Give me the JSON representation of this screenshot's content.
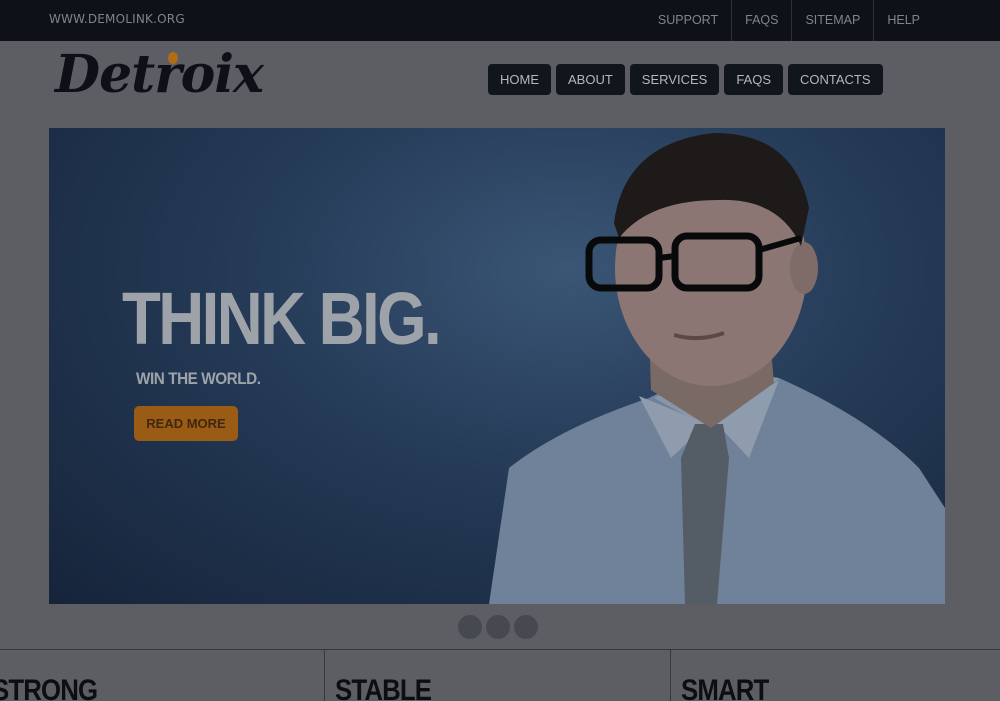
{
  "topbar": {
    "site_url": "WWW.DEMOLINK.ORG",
    "links": [
      "SUPPORT",
      "FAQS",
      "SITEMAP",
      "HELP"
    ]
  },
  "header": {
    "logo": "Detroix",
    "nav": [
      "HOME",
      "ABOUT",
      "SERVICES",
      "FAQS",
      "CONTACTS"
    ]
  },
  "hero": {
    "title": "THINK BIG.",
    "subtitle": "WIN THE WORLD.",
    "button_label": "READ MORE",
    "slide_count": 3
  },
  "features": [
    "STRONG",
    "STABLE",
    "SMART"
  ],
  "colors": {
    "overlay_bg": "#5c5e63",
    "topbar_bg": "#0e1118",
    "nav_button_bg": "#11151c",
    "accent_orange": "#9a5b15",
    "hero_blue": "#243a56"
  }
}
